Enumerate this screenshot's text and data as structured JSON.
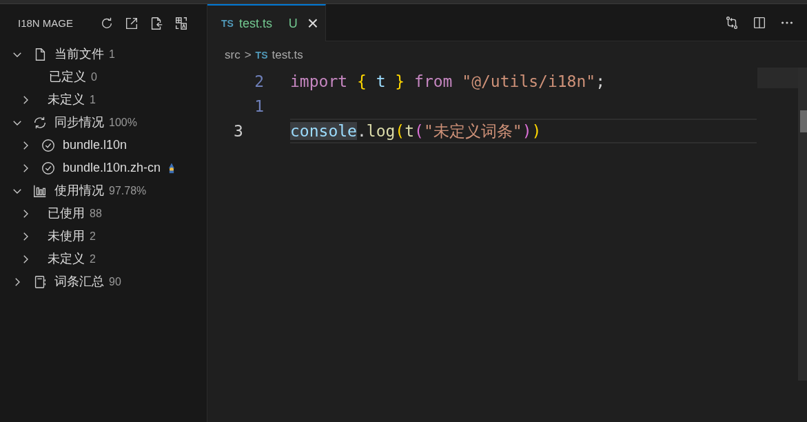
{
  "sidebar": {
    "title": "I18N MAGE",
    "tree": [
      {
        "label": "当前文件",
        "count": "1",
        "kind": "file",
        "leaf": false,
        "expanded": true,
        "children": [
          {
            "label": "已定义",
            "count": "0",
            "kind": "none",
            "leaf": true,
            "expanded": false
          },
          {
            "label": "未定义",
            "count": "1",
            "kind": "none",
            "leaf": false,
            "expanded": false
          }
        ]
      },
      {
        "label": "同步情况",
        "count": "100%",
        "kind": "sync",
        "leaf": false,
        "expanded": true,
        "children": [
          {
            "label": "bundle.l10n",
            "kind": "check",
            "leaf": false,
            "expanded": false
          },
          {
            "label": "bundle.l10n.zh-cn",
            "kind": "check-tagged",
            "leaf": false,
            "expanded": false
          }
        ]
      },
      {
        "label": "使用情况",
        "count": "97.78%",
        "kind": "chart",
        "leaf": false,
        "expanded": true,
        "children": [
          {
            "label": "已使用",
            "count": "88",
            "kind": "none",
            "leaf": false,
            "expanded": false
          },
          {
            "label": "未使用",
            "count": "2",
            "kind": "none",
            "leaf": false,
            "expanded": false
          },
          {
            "label": "未定义",
            "count": "2",
            "kind": "none",
            "leaf": false,
            "expanded": false
          }
        ]
      },
      {
        "label": "词条汇总",
        "count": "90",
        "kind": "notes",
        "leaf": false,
        "expanded": false
      }
    ]
  },
  "tabs": [
    {
      "icon_text": "TS",
      "label": "test.ts",
      "status": "U",
      "close": "×",
      "selected": true
    }
  ],
  "breadcrumb": {
    "folder": "src",
    "separator": ">",
    "icon_text": "TS",
    "file": "test.ts"
  },
  "code": [
    {
      "number": "2",
      "current": false,
      "tokens": [
        {
          "text": "import",
          "kind": "keyword"
        },
        {
          "text": " {",
          "kind": "brace"
        },
        {
          "text": " t",
          "kind": "var"
        },
        {
          "text": " }",
          "kind": "brace"
        },
        {
          "text": " from",
          "kind": "keyword"
        },
        {
          "text": " \"@/utils/i18n\"",
          "kind": "string"
        },
        {
          "text": ";",
          "kind": "plain"
        }
      ]
    },
    {
      "number": "1",
      "current": false
    },
    {
      "number": "3",
      "current": true,
      "tokens": [
        {
          "text": "console",
          "kind": "var-highlight"
        },
        {
          "text": ".",
          "kind": "plain"
        },
        {
          "text": "log",
          "kind": "func"
        },
        {
          "text": "(",
          "kind": "brace"
        },
        {
          "text": "t",
          "kind": "func"
        },
        {
          "text": "(",
          "kind": "paren2"
        },
        {
          "text": "\"未定义词条\"",
          "kind": "string"
        },
        {
          "text": ")",
          "kind": "paren2"
        },
        {
          "text": ")",
          "kind": "brace"
        }
      ]
    }
  ]
}
